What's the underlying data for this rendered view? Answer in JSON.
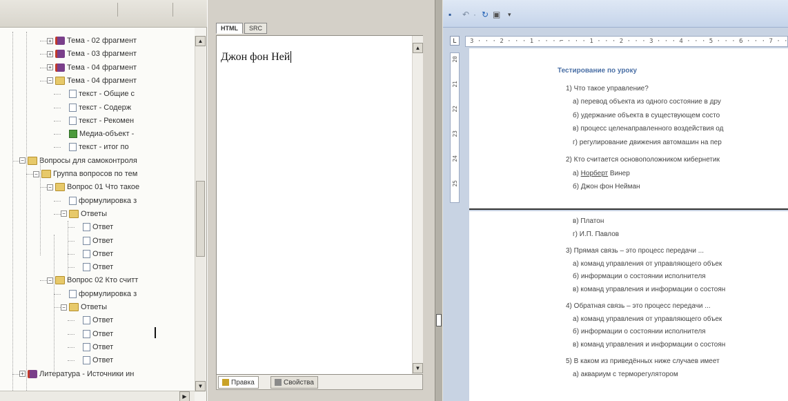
{
  "tree": {
    "items": [
      {
        "label": "Тема - 02 фрагмент",
        "icon": "book-icon",
        "expander": "+"
      },
      {
        "label": "Тема - 03 фрагмент",
        "icon": "book-icon",
        "expander": "+"
      },
      {
        "label": "Тема - 04 фрагмент",
        "icon": "book-icon",
        "expander": "+"
      },
      {
        "label": "Тема - 04 фрагмент",
        "icon": "folder-icon",
        "expander": "−"
      },
      {
        "label": "текст - Общие с",
        "icon": "document-icon",
        "expander": ""
      },
      {
        "label": "текст - Содерж",
        "icon": "document-icon",
        "expander": ""
      },
      {
        "label": "текст - Рекомен",
        "icon": "document-icon",
        "expander": ""
      },
      {
        "label": "Медиа-объект -",
        "icon": "media-icon",
        "expander": ""
      },
      {
        "label": "текст - итог по",
        "icon": "document-icon",
        "expander": ""
      },
      {
        "label": "Вопросы для самоконтроля",
        "icon": "folder-icon",
        "expander": "−"
      },
      {
        "label": "Группа вопросов по тем",
        "icon": "folder-icon",
        "expander": "−"
      },
      {
        "label": "Вопрос 01 Что такое",
        "icon": "folder-icon",
        "expander": "−"
      },
      {
        "label": "формулировка з",
        "icon": "document-icon",
        "expander": ""
      },
      {
        "label": "Ответы",
        "icon": "folder-icon",
        "expander": "−"
      },
      {
        "label": "Ответ",
        "icon": "document-icon",
        "expander": ""
      },
      {
        "label": "Ответ",
        "icon": "document-icon",
        "expander": ""
      },
      {
        "label": "Ответ",
        "icon": "document-icon",
        "expander": ""
      },
      {
        "label": "Ответ",
        "icon": "document-icon",
        "expander": ""
      },
      {
        "label": "Вопрос 02 Кто считт",
        "icon": "folder-icon",
        "expander": "−"
      },
      {
        "label": "формулировка з",
        "icon": "document-icon",
        "expander": ""
      },
      {
        "label": "Ответы",
        "icon": "folder-icon",
        "expander": "−"
      },
      {
        "label": "Ответ",
        "icon": "document-icon",
        "expander": ""
      },
      {
        "label": "Ответ",
        "icon": "document-icon",
        "expander": ""
      },
      {
        "label": "Ответ",
        "icon": "document-icon",
        "expander": ""
      },
      {
        "label": "Ответ",
        "icon": "document-icon",
        "expander": ""
      },
      {
        "label": "Литература - Источники ин",
        "icon": "book-icon",
        "expander": "+"
      }
    ]
  },
  "editor": {
    "tabs": [
      "HTML",
      "SRC"
    ],
    "content": "Джон фон Ней",
    "bottom_tabs": [
      "Правка",
      "Свойства"
    ]
  },
  "word": {
    "ruler_h": "3 · · · 2 · · · 1 · · · ⌐ · · · 1 · · · 2 · · · 3 · · · 4 · · · 5 · · · 6 · · · 7 · · · 8 · ·",
    "ruler_v": [
      "20",
      "21",
      "22",
      "23",
      "24",
      "25"
    ],
    "ruler_corner": "L",
    "page1": [
      {
        "text": "Тестирование по уроку",
        "style": "title"
      },
      {
        "text": "1)   Что такое управление?",
        "style": "q"
      },
      {
        "text": "а) перевод объекта из одного состояние в дру",
        "style": "a"
      },
      {
        "text": "б)  удержание объекта  в существующем состо",
        "style": "a"
      },
      {
        "text": "в) процесс целенаправленного  воздействия од",
        "style": "a"
      },
      {
        "text": "г) регулирование движения автомашин на пер",
        "style": "a"
      },
      {
        "text": "2)   Кто считается основоположником  кибернетик",
        "style": "q"
      },
      {
        "text": "а) Норберт Винер",
        "style": "a-link"
      },
      {
        "text": "б)  Джон фон Нейман",
        "style": "a"
      }
    ],
    "page2": [
      {
        "text": "в) Платон",
        "style": "a"
      },
      {
        "text": "г) И.П. Павлов",
        "style": "a"
      },
      {
        "text": "3)   Прямая связь – это процесс передачи ...",
        "style": "q"
      },
      {
        "text": "а) команд управления от управляющего  объек",
        "style": "a"
      },
      {
        "text": "б)  информации о состоянии исполнителя",
        "style": "a"
      },
      {
        "text": "в) команд управления  и информации о состоян",
        "style": "a"
      },
      {
        "text": "4)   Обратная связь – это процесс передачи ...",
        "style": "q"
      },
      {
        "text": "а) команд управления от управляющего  объек",
        "style": "a"
      },
      {
        "text": "б)  информации о состоянии исполнителя",
        "style": "a"
      },
      {
        "text": "в) команд управления  и информации о состоян",
        "style": "a"
      },
      {
        "text": "5)   В каком из приведённых ниже случаев имеет",
        "style": "q"
      },
      {
        "text": "а) аквариум с терморегулятором",
        "style": "a"
      }
    ],
    "link_word": "Норберт"
  }
}
